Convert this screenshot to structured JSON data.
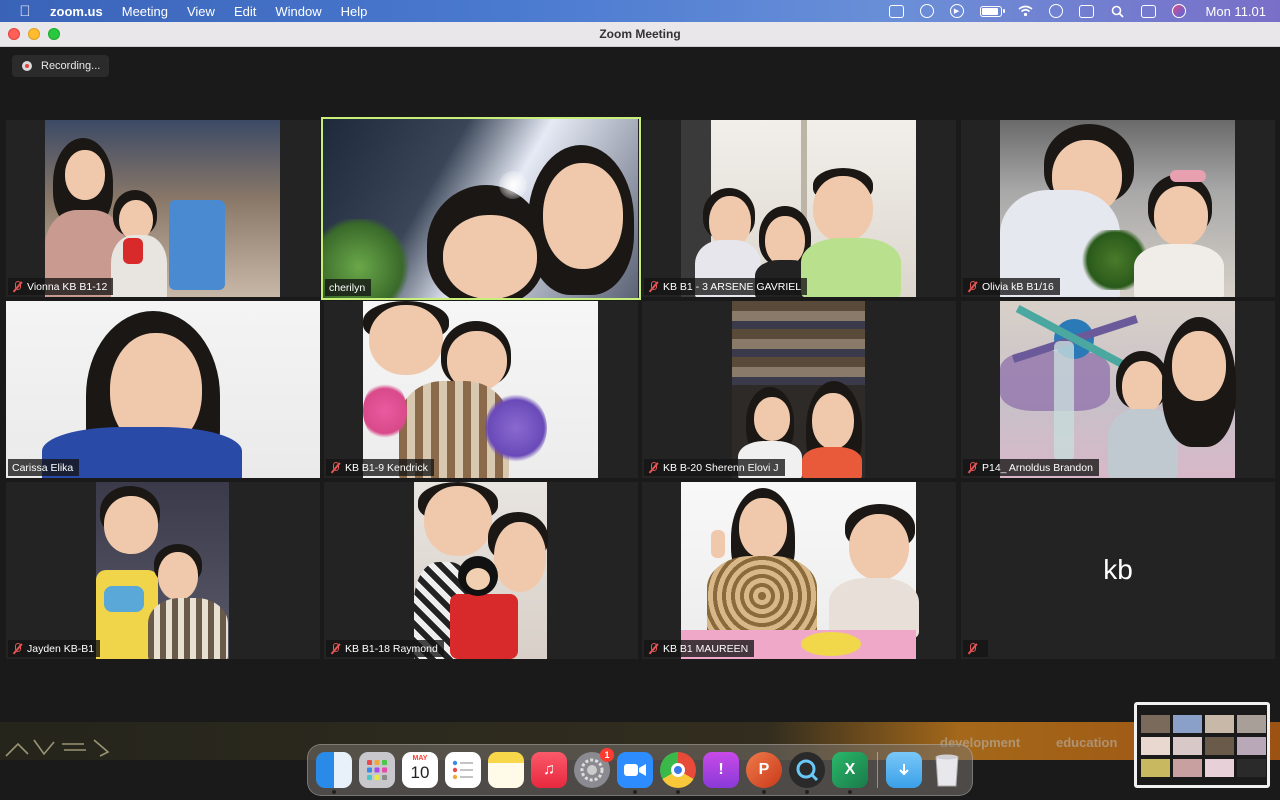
{
  "menubar": {
    "app_name": "zoom.us",
    "menus": [
      "Meeting",
      "View",
      "Edit",
      "Window",
      "Help"
    ],
    "clock": "Mon 11.01",
    "battery_level": 0.8,
    "status_icons": [
      "zoom-icon",
      "creative-cloud-icon",
      "play-icon",
      "battery-icon",
      "wifi-icon",
      "user-icon",
      "display-icon",
      "search-icon",
      "control-center-icon",
      "siri-icon"
    ]
  },
  "window": {
    "title": "Zoom Meeting",
    "recording_label": "Recording..."
  },
  "participants": [
    {
      "name": "Vionna KB B1-12",
      "muted": true,
      "active": false
    },
    {
      "name": "cherilyn",
      "muted": false,
      "active": true
    },
    {
      "name": "KB B1 - 3 ARSENE GAVRIEL",
      "muted": true,
      "active": false
    },
    {
      "name": "Olivia kB B1/16",
      "muted": true,
      "active": false
    },
    {
      "name": "Carissa Elika",
      "muted": false,
      "active": false
    },
    {
      "name": "KB B1-9 Kendrick",
      "muted": true,
      "active": false
    },
    {
      "name": "KB B-20 Sherenn Elovi J",
      "muted": true,
      "active": false
    },
    {
      "name": "P14_ Arnoldus Brandon",
      "muted": true,
      "active": false
    },
    {
      "name": "Jayden KB-B1",
      "muted": true,
      "active": false
    },
    {
      "name": "KB B1-18 Raymond",
      "muted": true,
      "active": false
    },
    {
      "name": "KB B1 MAUREEN",
      "muted": true,
      "active": false
    },
    {
      "name": "",
      "muted": true,
      "active": false,
      "avatar_text": "kb"
    }
  ],
  "desktop_text": {
    "left": "development",
    "right": "education"
  },
  "dock": {
    "calendar_month": "MAY",
    "calendar_day": "10",
    "settings_badge": "1",
    "apps": [
      "finder-icon",
      "launchpad-icon",
      "calendar-icon",
      "reminders-icon",
      "notes-icon",
      "music-icon",
      "system-preferences-icon",
      "zoom-icon",
      "chrome-icon",
      "feedback-icon",
      "powerpoint-icon",
      "quicktime-icon",
      "excel-icon",
      "downloads-folder-icon",
      "trash-icon"
    ]
  }
}
